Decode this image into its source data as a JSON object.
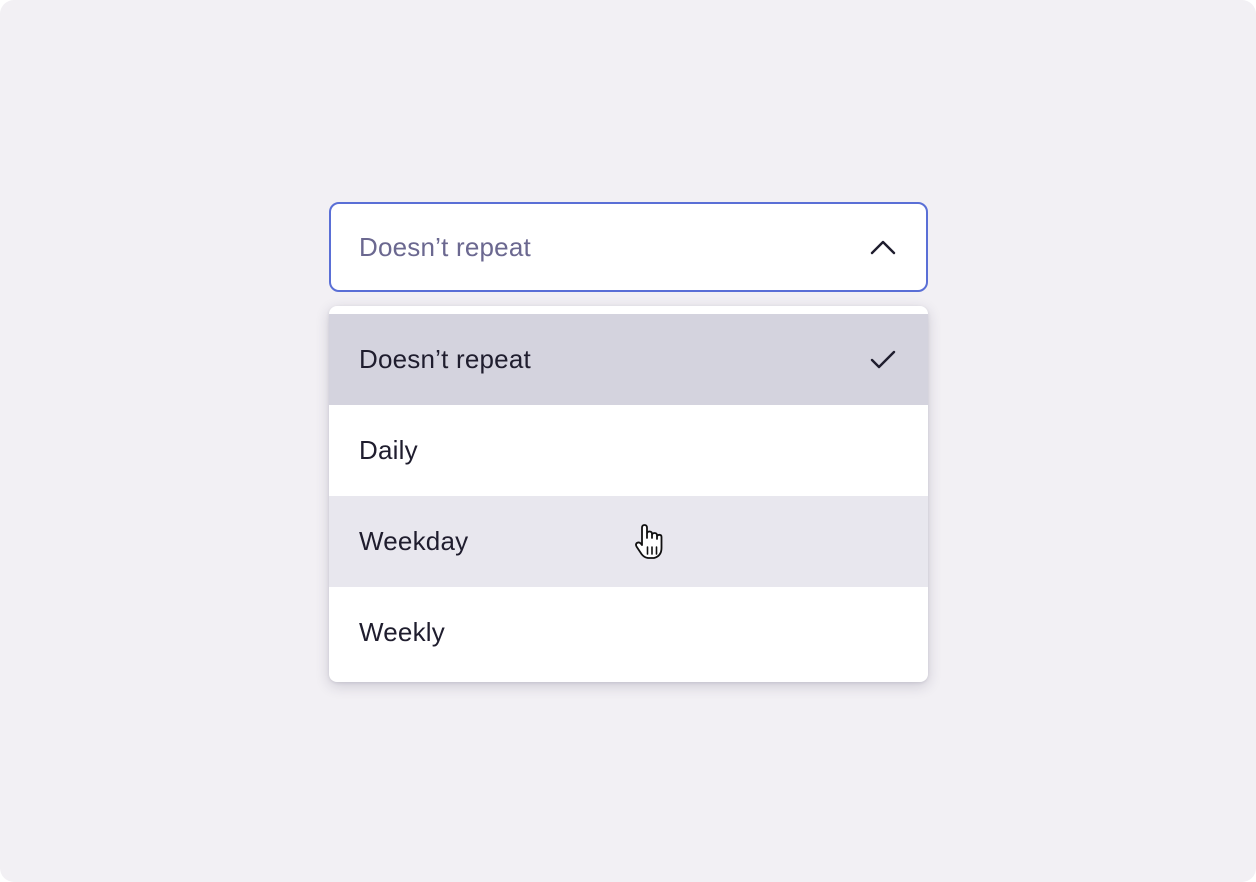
{
  "select": {
    "value": "Doesn’t repeat",
    "expanded": true,
    "chevron_icon": "chevron-up-icon",
    "border_color": "#5a6fd6"
  },
  "menu": {
    "options": [
      {
        "label": "Doesn’t repeat",
        "state": "selected",
        "icon": "check-icon"
      },
      {
        "label": "Daily",
        "state": "default"
      },
      {
        "label": "Weekday",
        "state": "hovered"
      },
      {
        "label": "Weekly",
        "state": "default"
      }
    ],
    "colors": {
      "selected_bg": "#d4d3de",
      "hover_bg": "#e8e7ee"
    }
  },
  "cursor": {
    "icon": "hand-pointer-icon"
  }
}
